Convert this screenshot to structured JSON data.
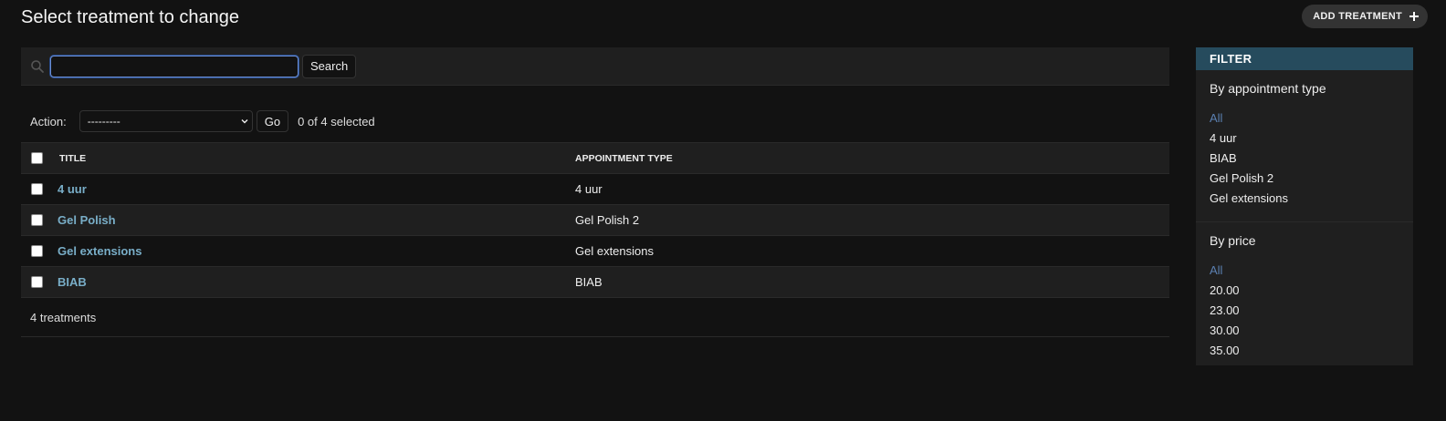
{
  "header": {
    "title": "Select treatment to change",
    "add_button": "ADD TREATMENT"
  },
  "search": {
    "value": "",
    "placeholder": "",
    "button": "Search"
  },
  "actions": {
    "label": "Action:",
    "selected_option": "---------",
    "go_button": "Go",
    "selected_count": "0 of 4 selected"
  },
  "table": {
    "columns": [
      "TITLE",
      "APPOINTMENT TYPE"
    ],
    "rows": [
      {
        "title": "4 uur",
        "appointment_type": "4 uur"
      },
      {
        "title": "Gel Polish",
        "appointment_type": "Gel Polish 2"
      },
      {
        "title": "Gel extensions",
        "appointment_type": "Gel extensions"
      },
      {
        "title": "BIAB",
        "appointment_type": "BIAB"
      }
    ],
    "footer": "4 treatments"
  },
  "filter": {
    "heading": "FILTER",
    "sections": [
      {
        "title": "By appointment type",
        "items": [
          "All",
          "4 uur",
          "BIAB",
          "Gel Polish 2",
          "Gel extensions"
        ],
        "selected": "All"
      },
      {
        "title": "By price",
        "items": [
          "All",
          "20.00",
          "23.00",
          "30.00",
          "35.00"
        ],
        "selected": "All"
      }
    ]
  },
  "colors": {
    "background": "#121212",
    "link": "#79aec8",
    "filter_header": "#264b5d",
    "filter_selected": "#5b80b2"
  }
}
